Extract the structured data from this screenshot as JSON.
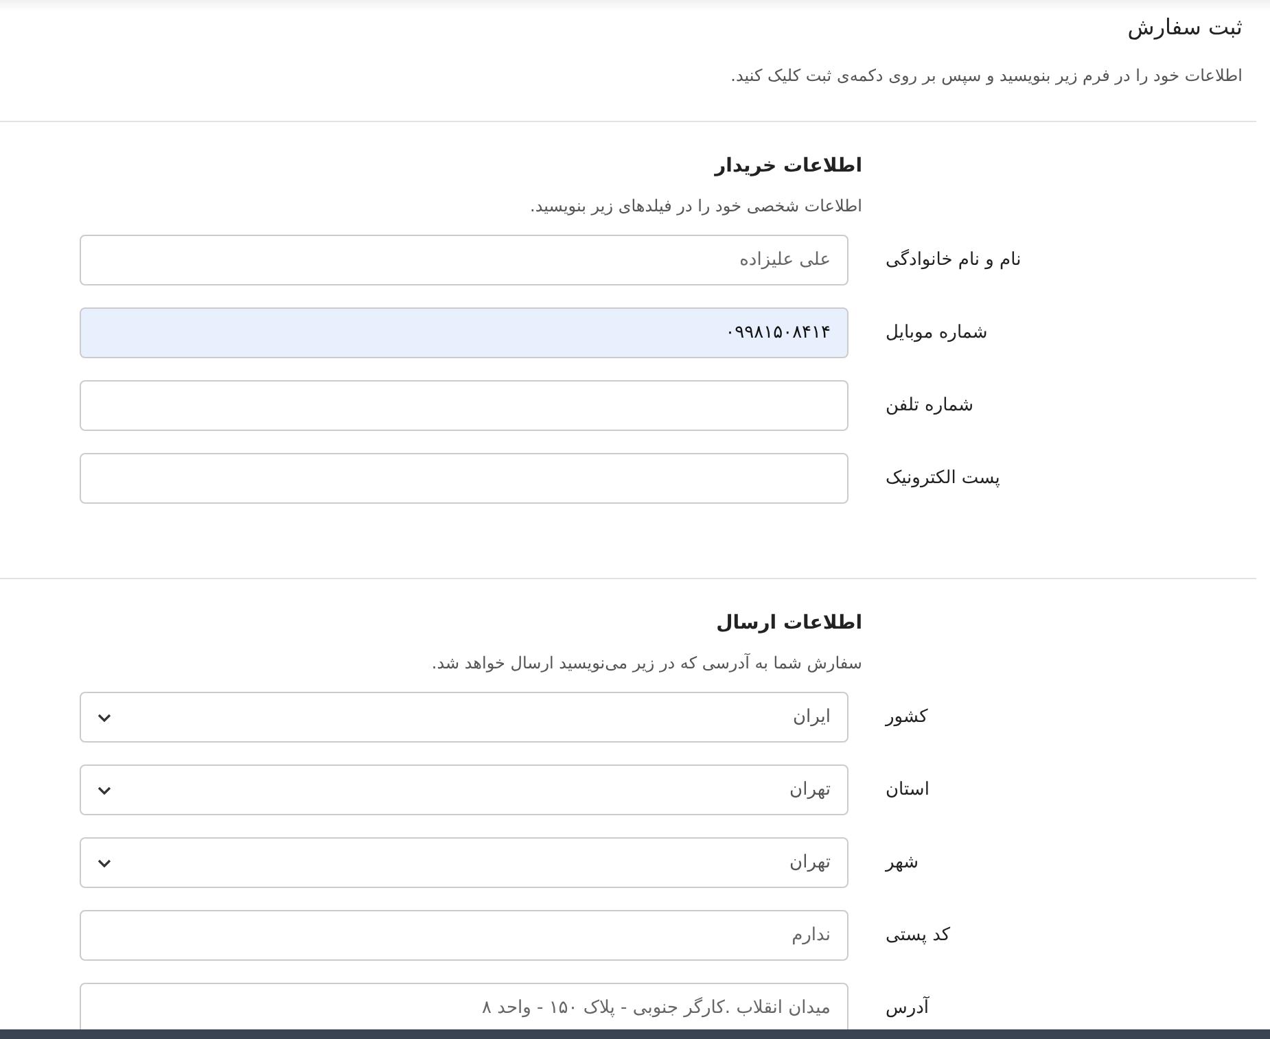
{
  "page": {
    "title": "ثبت سفارش",
    "description": "اطلاعات خود را در فرم زیر بنویسید و سپس بر روی دکمه‌ی ثبت کلیک کنید."
  },
  "sections": [
    {
      "title": "اطلاعات خریدار",
      "description": "اطلاعات شخصی خود را در فیلدهای زیر بنویسید.",
      "fields": [
        {
          "kind": "text",
          "label": "نام و نام خانوادگی",
          "placeholder": "علی علیزاده"
        },
        {
          "kind": "text",
          "label": "شماره موبایل",
          "value": "۰۹۹۸۱۵۰۸۴۱۴",
          "autofilled": true
        },
        {
          "kind": "text",
          "label": "شماره تلفن"
        },
        {
          "kind": "text",
          "label": "پست الکترونیک"
        }
      ]
    },
    {
      "title": "اطلاعات ارسال",
      "description": "سفارش شما به آدرسی که در زیر می‌نویسید ارسال خواهد شد.",
      "fields": [
        {
          "kind": "select",
          "label": "کشور",
          "value": "ایران"
        },
        {
          "kind": "select",
          "label": "استان",
          "value": "تهران"
        },
        {
          "kind": "select",
          "label": "شهر",
          "value": "تهران"
        },
        {
          "kind": "text",
          "label": "کد پستی",
          "placeholder": "ندارم"
        },
        {
          "kind": "text",
          "label": "آدرس",
          "placeholder": "میدان انقلاب .کارگر جنوبی - پلاک ۱۵۰ - واحد ۸"
        }
      ]
    }
  ]
}
